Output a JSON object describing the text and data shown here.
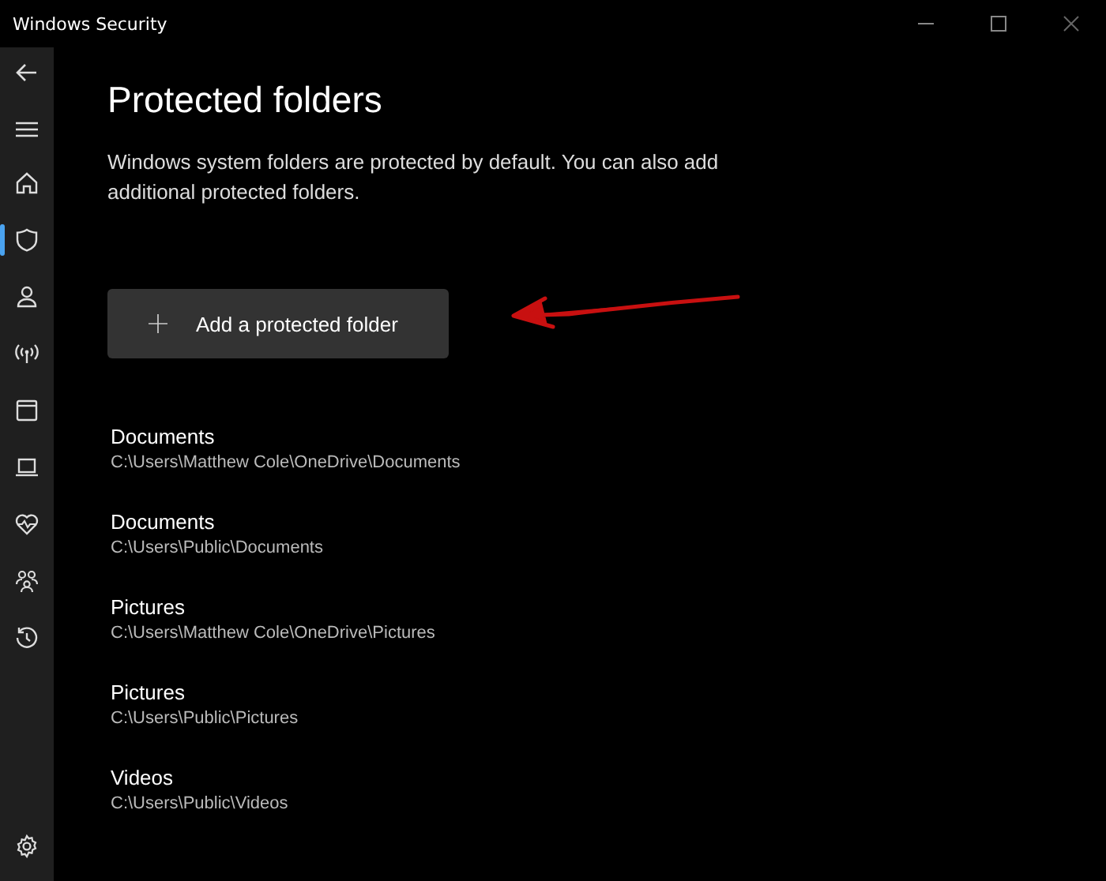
{
  "window": {
    "title": "Windows Security"
  },
  "sidebar": {
    "items": [
      {
        "kind": "home",
        "selected": false
      },
      {
        "kind": "shield",
        "selected": true
      },
      {
        "kind": "account",
        "selected": false
      },
      {
        "kind": "network",
        "selected": false
      },
      {
        "kind": "browser",
        "selected": false
      },
      {
        "kind": "device",
        "selected": false
      },
      {
        "kind": "health",
        "selected": false
      },
      {
        "kind": "family",
        "selected": false
      },
      {
        "kind": "history",
        "selected": false
      }
    ]
  },
  "page": {
    "title": "Protected folders",
    "description": "Windows system folders are protected by default. You can also add additional protected folders.",
    "add_button": "Add a protected folder"
  },
  "folders": [
    {
      "name": "Documents",
      "path": "C:\\Users\\Matthew Cole\\OneDrive\\Documents"
    },
    {
      "name": "Documents",
      "path": "C:\\Users\\Public\\Documents"
    },
    {
      "name": "Pictures",
      "path": "C:\\Users\\Matthew Cole\\OneDrive\\Pictures"
    },
    {
      "name": "Pictures",
      "path": "C:\\Users\\Public\\Pictures"
    },
    {
      "name": "Videos",
      "path": "C:\\Users\\Public\\Videos"
    }
  ]
}
